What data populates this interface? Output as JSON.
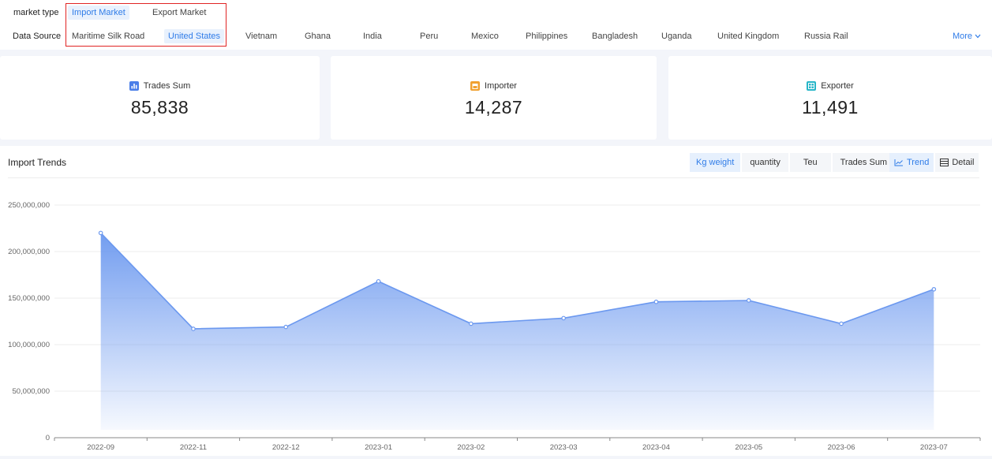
{
  "filters": {
    "market_type": {
      "label": "market type",
      "options": [
        "Import Market",
        "Export Market"
      ],
      "selected": "Import Market"
    },
    "data_source": {
      "label": "Data Source",
      "options": [
        "Maritime Silk Road",
        "United States",
        "Vietnam",
        "Ghana",
        "India",
        "Peru",
        "Mexico",
        "Philippines",
        "Bangladesh",
        "Uganda",
        "United Kingdom",
        "Russia Rail"
      ],
      "selected": "United States"
    },
    "more_label": "More"
  },
  "stats": [
    {
      "label": "Trades Sum",
      "value": "85,838",
      "icon": "bar-chart-icon",
      "color": "#4a7ee8"
    },
    {
      "label": "Importer",
      "value": "14,287",
      "icon": "store-icon",
      "color": "#f0a030"
    },
    {
      "label": "Exporter",
      "value": "11,491",
      "icon": "building-icon",
      "color": "#28b6c8"
    }
  ],
  "trends": {
    "title": "Import Trends",
    "metric_tabs": [
      "Kg weight",
      "quantity",
      "Teu",
      "Trades Sum"
    ],
    "metric_selected": "Kg weight",
    "view_tabs": [
      "Trend",
      "Detail"
    ],
    "view_selected": "Trend"
  },
  "chart_data": {
    "type": "area",
    "categories": [
      "2022-09",
      "2022-11",
      "2022-12",
      "2023-01",
      "2023-02",
      "2023-03",
      "2023-04",
      "2023-05",
      "2023-06",
      "2023-07"
    ],
    "values": [
      220000000,
      117000000,
      119000000,
      168000000,
      122500000,
      128500000,
      146000000,
      147500000,
      122500000,
      159500000
    ],
    "yticks": [
      "0",
      "50,000,000",
      "100,000,000",
      "150,000,000",
      "200,000,000",
      "250,000,000"
    ],
    "ylim": [
      0,
      250000000
    ],
    "grid": true,
    "color": "#6b98ef"
  }
}
